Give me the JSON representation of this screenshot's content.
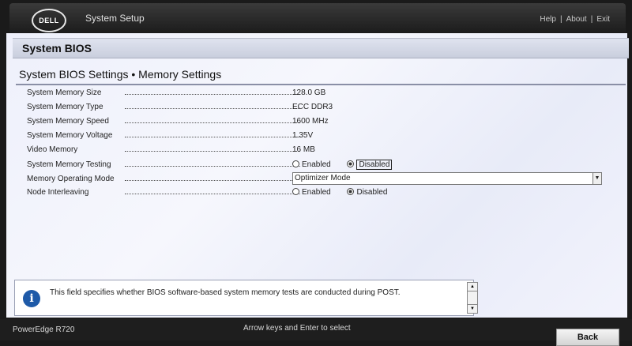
{
  "topbar": {
    "logo": "DELL",
    "title": "System Setup",
    "links": [
      "Help",
      "About",
      "Exit"
    ],
    "separator": "|"
  },
  "panel": {
    "section_title": "System BIOS",
    "page_title": "System BIOS Settings • Memory Settings"
  },
  "settings": {
    "memory_size": {
      "label": "System Memory Size",
      "value": "128.0 GB"
    },
    "memory_type": {
      "label": "System Memory Type",
      "value": "ECC DDR3"
    },
    "memory_speed": {
      "label": "System Memory Speed",
      "value": "1600 MHz"
    },
    "memory_voltage": {
      "label": "System Memory Voltage",
      "value": "1.35V"
    },
    "video_memory": {
      "label": "Video Memory",
      "value": "16 MB"
    },
    "memory_testing": {
      "label": "System Memory Testing",
      "options": [
        "Enabled",
        "Disabled"
      ],
      "selected": "Disabled"
    },
    "operating_mode": {
      "label": "Memory Operating Mode",
      "value": "Optimizer Mode"
    },
    "node_interleaving": {
      "label": "Node Interleaving",
      "options": [
        "Enabled",
        "Disabled"
      ],
      "selected": "Disabled"
    }
  },
  "help": {
    "text": "This field specifies whether BIOS software-based system memory tests are conducted during POST."
  },
  "footer": {
    "model": "PowerEdge R720",
    "hint": "Arrow keys and Enter to select",
    "back_label": "Back"
  }
}
